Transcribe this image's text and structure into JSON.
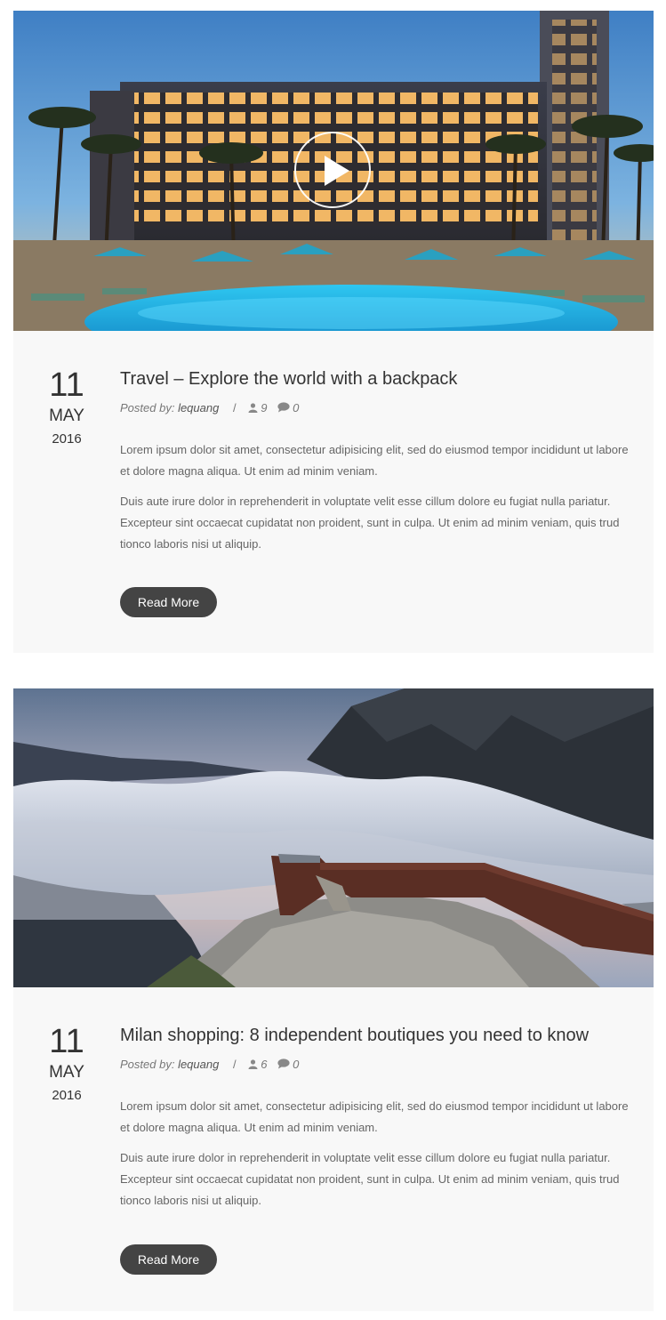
{
  "posts": [
    {
      "image": "hotel-pool-night-photo",
      "has_video": true,
      "date": {
        "day": "11",
        "month": "MAY",
        "year": "2016"
      },
      "title": "Travel – Explore the world with a backpack",
      "posted_by_label": "Posted by:",
      "author": "lequang",
      "separator": "/",
      "views": "9",
      "comments": "0",
      "paragraphs": [
        "Lorem ipsum dolor sit amet, consectetur adipisicing elit, sed do eiusmod tempor incididunt ut labore et dolore magna aliqua. Ut enim ad minim veniam.",
        "Duis aute irure dolor in reprehenderit in voluptate velit esse cillum dolore eu fugiat nulla pariatur. Excepteur sint occaecat cupidatat non proident, sunt in culpa. Ut enim ad minim veniam, quis trud tionco laboris nisi ut aliquip."
      ],
      "read_more": "Read More"
    },
    {
      "image": "mountain-viewpoint-clouds-photo",
      "has_video": false,
      "date": {
        "day": "11",
        "month": "MAY",
        "year": "2016"
      },
      "title": "Milan shopping: 8 independent boutiques you need to know",
      "posted_by_label": "Posted by:",
      "author": "lequang",
      "separator": "/",
      "views": "6",
      "comments": "0",
      "paragraphs": [
        "Lorem ipsum dolor sit amet, consectetur adipisicing elit, sed do eiusmod tempor incididunt ut labore et dolore magna aliqua. Ut enim ad minim veniam.",
        "Duis aute irure dolor in reprehenderit in voluptate velit esse cillum dolore eu fugiat nulla pariatur. Excepteur sint occaecat cupidatat non proident, sunt in culpa. Ut enim ad minim veniam, quis trud tionco laboris nisi ut aliquip."
      ],
      "read_more": "Read More"
    }
  ],
  "icons": {
    "views": "user-icon",
    "comments": "comment-icon",
    "video": "play-icon"
  },
  "colors": {
    "button": "#444444",
    "card_background": "#f8f8f8",
    "text": "#333333",
    "muted": "#777777"
  }
}
